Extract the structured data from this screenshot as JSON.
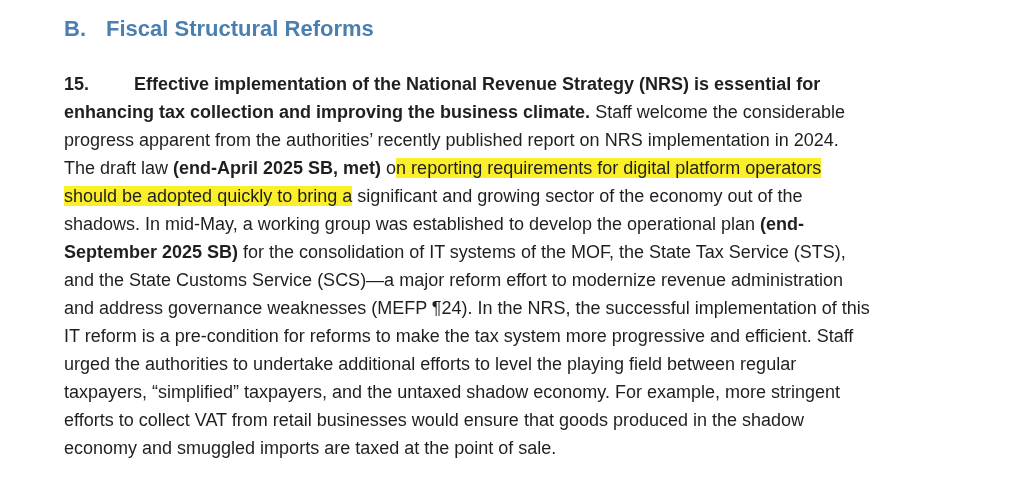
{
  "heading": {
    "letter": "B.",
    "title": "Fiscal Structural Reforms"
  },
  "paragraph": {
    "number": "15.",
    "lines": [
      [
        {
          "text": "**Effective implementation of the National Revenue Strategy (NRS) is essential for**",
          "highlighted": false
        }
      ],
      [
        {
          "text": "**enhancing tax collection and improving the business climate.** Staff welcome the considerable",
          "highlighted": false
        }
      ],
      [
        {
          "text": "progress apparent from the authorities’ recently published report on NRS implementation in 2024.",
          "highlighted": false
        }
      ],
      [
        {
          "text": "The draft law **(end-April 2025 SB, met)** o",
          "highlighted": false
        },
        {
          "text": "n reporting requirements for digital platform operators",
          "highlighted": true
        }
      ],
      [
        {
          "text": "should be adopted quickly to bring a",
          "highlighted": true
        },
        {
          "text": " significant and growing sector of the economy out of the",
          "highlighted": false
        }
      ],
      [
        {
          "text": "shadows. In mid-May, a working group was established to develop the operational plan **(end-**",
          "highlighted": false
        }
      ],
      [
        {
          "text": "**September 2025 SB)** for the consolidation of IT systems of the MOF, the State Tax Service (STS),",
          "highlighted": false
        }
      ],
      [
        {
          "text": "and the State Customs Service (SCS)—a major reform effort to modernize revenue administration",
          "highlighted": false
        }
      ],
      [
        {
          "text": "and address governance weaknesses (MEFP ¶24). In the NRS, the successful implementation of this",
          "highlighted": false
        }
      ],
      [
        {
          "text": "IT reform is a pre-condition for reforms to make the tax system more progressive and efficient. Staff",
          "highlighted": false
        }
      ],
      [
        {
          "text": "urged the authorities to undertake additional efforts to level the playing field between regular",
          "highlighted": false
        }
      ],
      [
        {
          "text": "taxpayers, “simplified” taxpayers, and the untaxed shadow economy. For example, more stringent",
          "highlighted": false
        }
      ],
      [
        {
          "text": "efforts to collect VAT from retail businesses would ensure that goods produced in the shadow",
          "highlighted": false
        }
      ],
      [
        {
          "text": "economy and smuggled imports are taxed at the point of sale.",
          "highlighted": false
        }
      ]
    ]
  }
}
